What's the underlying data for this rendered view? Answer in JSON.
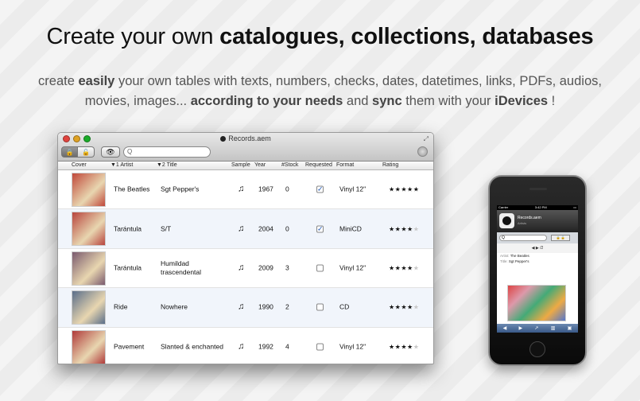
{
  "headline": {
    "part1": "Create your own ",
    "bold": "catalogues, collections, databases"
  },
  "subtitle": {
    "p1": "create ",
    "b1": "easily",
    "p2": " your own tables with texts, numbers, checks, dates, datetimes, links, PDFs, audios, movies, images... ",
    "b2": "according to your needs",
    "p3": " and ",
    "b3": "sync",
    "p4": " them with your ",
    "b4": "iDevices",
    "p5": " !"
  },
  "window": {
    "title": "Records.aem",
    "search_placeholder": "Q",
    "columns": {
      "cover": "Cover",
      "artist": "▼1 Artist",
      "title": "▼2 Title",
      "sample": "Sample",
      "year": "Year",
      "stock": "#Stock",
      "requested": "Requested",
      "format": "Format",
      "rating": "Rating"
    },
    "rows": [
      {
        "artist": "The Beatles",
        "title": "Sgt Pepper's",
        "year": "1967",
        "stock": "0",
        "requested": true,
        "format": "Vinyl 12\"",
        "rating": 5
      },
      {
        "artist": "Tarántula",
        "title": "S/T",
        "year": "2004",
        "stock": "0",
        "requested": true,
        "format": "MiniCD",
        "rating": 4
      },
      {
        "artist": "Tarántula",
        "title": "Humildad trascendental",
        "year": "2009",
        "stock": "3",
        "requested": false,
        "format": "Vinyl 12\"",
        "rating": 4
      },
      {
        "artist": "Ride",
        "title": "Nowhere",
        "year": "1990",
        "stock": "2",
        "requested": false,
        "format": "CD",
        "rating": 4
      },
      {
        "artist": "Pavement",
        "title": "Slanted & enchanted",
        "year": "1992",
        "stock": "4",
        "requested": false,
        "format": "Vinyl 12\"",
        "rating": 4
      }
    ],
    "cover_colors": [
      "#c0483a",
      "#b8453e",
      "#7a5a6e",
      "#5a6e8a",
      "#b03a3a"
    ]
  },
  "phone": {
    "carrier": "Carrier",
    "time": "3:42 PM",
    "app_title": "Records.aem",
    "app_subtitle": "Artists",
    "nav": "◀ ▶ /2",
    "artist_label": "Artist:",
    "artist_value": "The Beatles",
    "title_label": "Title:",
    "title_value": "Sgt Pepper's"
  }
}
